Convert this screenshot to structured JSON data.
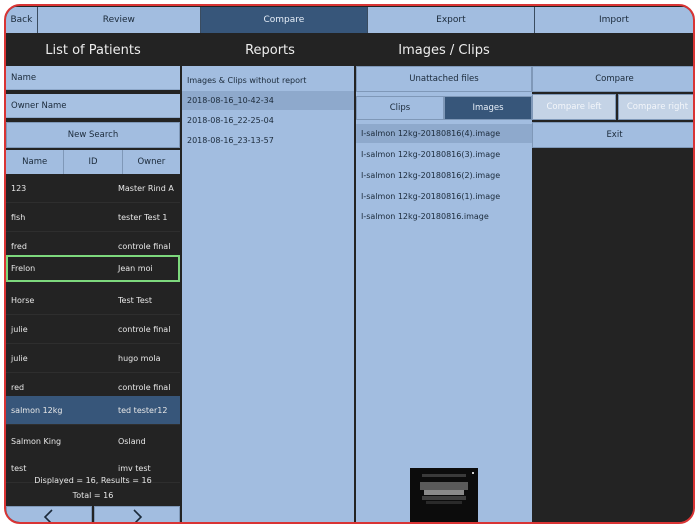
{
  "topbar": {
    "back": "Back",
    "review": "Review",
    "compare": "Compare",
    "export": "Export",
    "import": "Import"
  },
  "headers": {
    "patients": "List of Patients",
    "reports": "Reports",
    "images": "Images / Clips"
  },
  "patients_panel": {
    "name_placeholder": "Name",
    "owner_placeholder": "Owner Name",
    "new_search": "New Search",
    "columns": [
      "Name",
      "ID",
      "Owner"
    ],
    "rows": [
      {
        "name": "123",
        "owner": "Master Rind A"
      },
      {
        "name": "fish",
        "owner": "tester Test 1"
      },
      {
        "name": "fred",
        "owner": "controle final"
      },
      {
        "name": "Frelon",
        "owner": "Jean moi"
      },
      {
        "name": "Horse",
        "owner": "Test Test"
      },
      {
        "name": "julie",
        "owner": "controle final"
      },
      {
        "name": "julie",
        "owner": "hugo mola"
      },
      {
        "name": "red",
        "owner": "controle final"
      },
      {
        "name": "salmon 12kg",
        "owner": "ted tester12"
      },
      {
        "name": "Salmon King",
        "owner": "Osland"
      },
      {
        "name": "test",
        "owner": "imv test"
      }
    ],
    "displayed": "Displayed = 16, Results = 16",
    "total": "Total = 16",
    "prev_icon": "chevron-left-icon",
    "next_icon": "chevron-right-icon"
  },
  "reports": {
    "items": [
      "Images & Clips without report",
      "2018-08-16_10-42-34",
      "2018-08-16_22-25-04",
      "2018-08-16_23-13-57"
    ]
  },
  "media": {
    "unattached": "Unattached files",
    "tab_clips": "Clips",
    "tab_images": "Images",
    "files": [
      "I-salmon 12kg-20180816(4).image",
      "I-salmon 12kg-20180816(3).image",
      "I-salmon 12kg-20180816(2).image",
      "I-salmon 12kg-20180816(1).image",
      "I-salmon 12kg-20180816.image"
    ]
  },
  "actions": {
    "compare": "Compare",
    "compare_left": "Compare left",
    "compare_right": "Compare right",
    "exit": "Exit"
  },
  "colors": {
    "accent": "#37567a",
    "panel": "#a2bde0",
    "background": "#232323",
    "frame": "#d93434",
    "highlight": "#7dd87d"
  }
}
